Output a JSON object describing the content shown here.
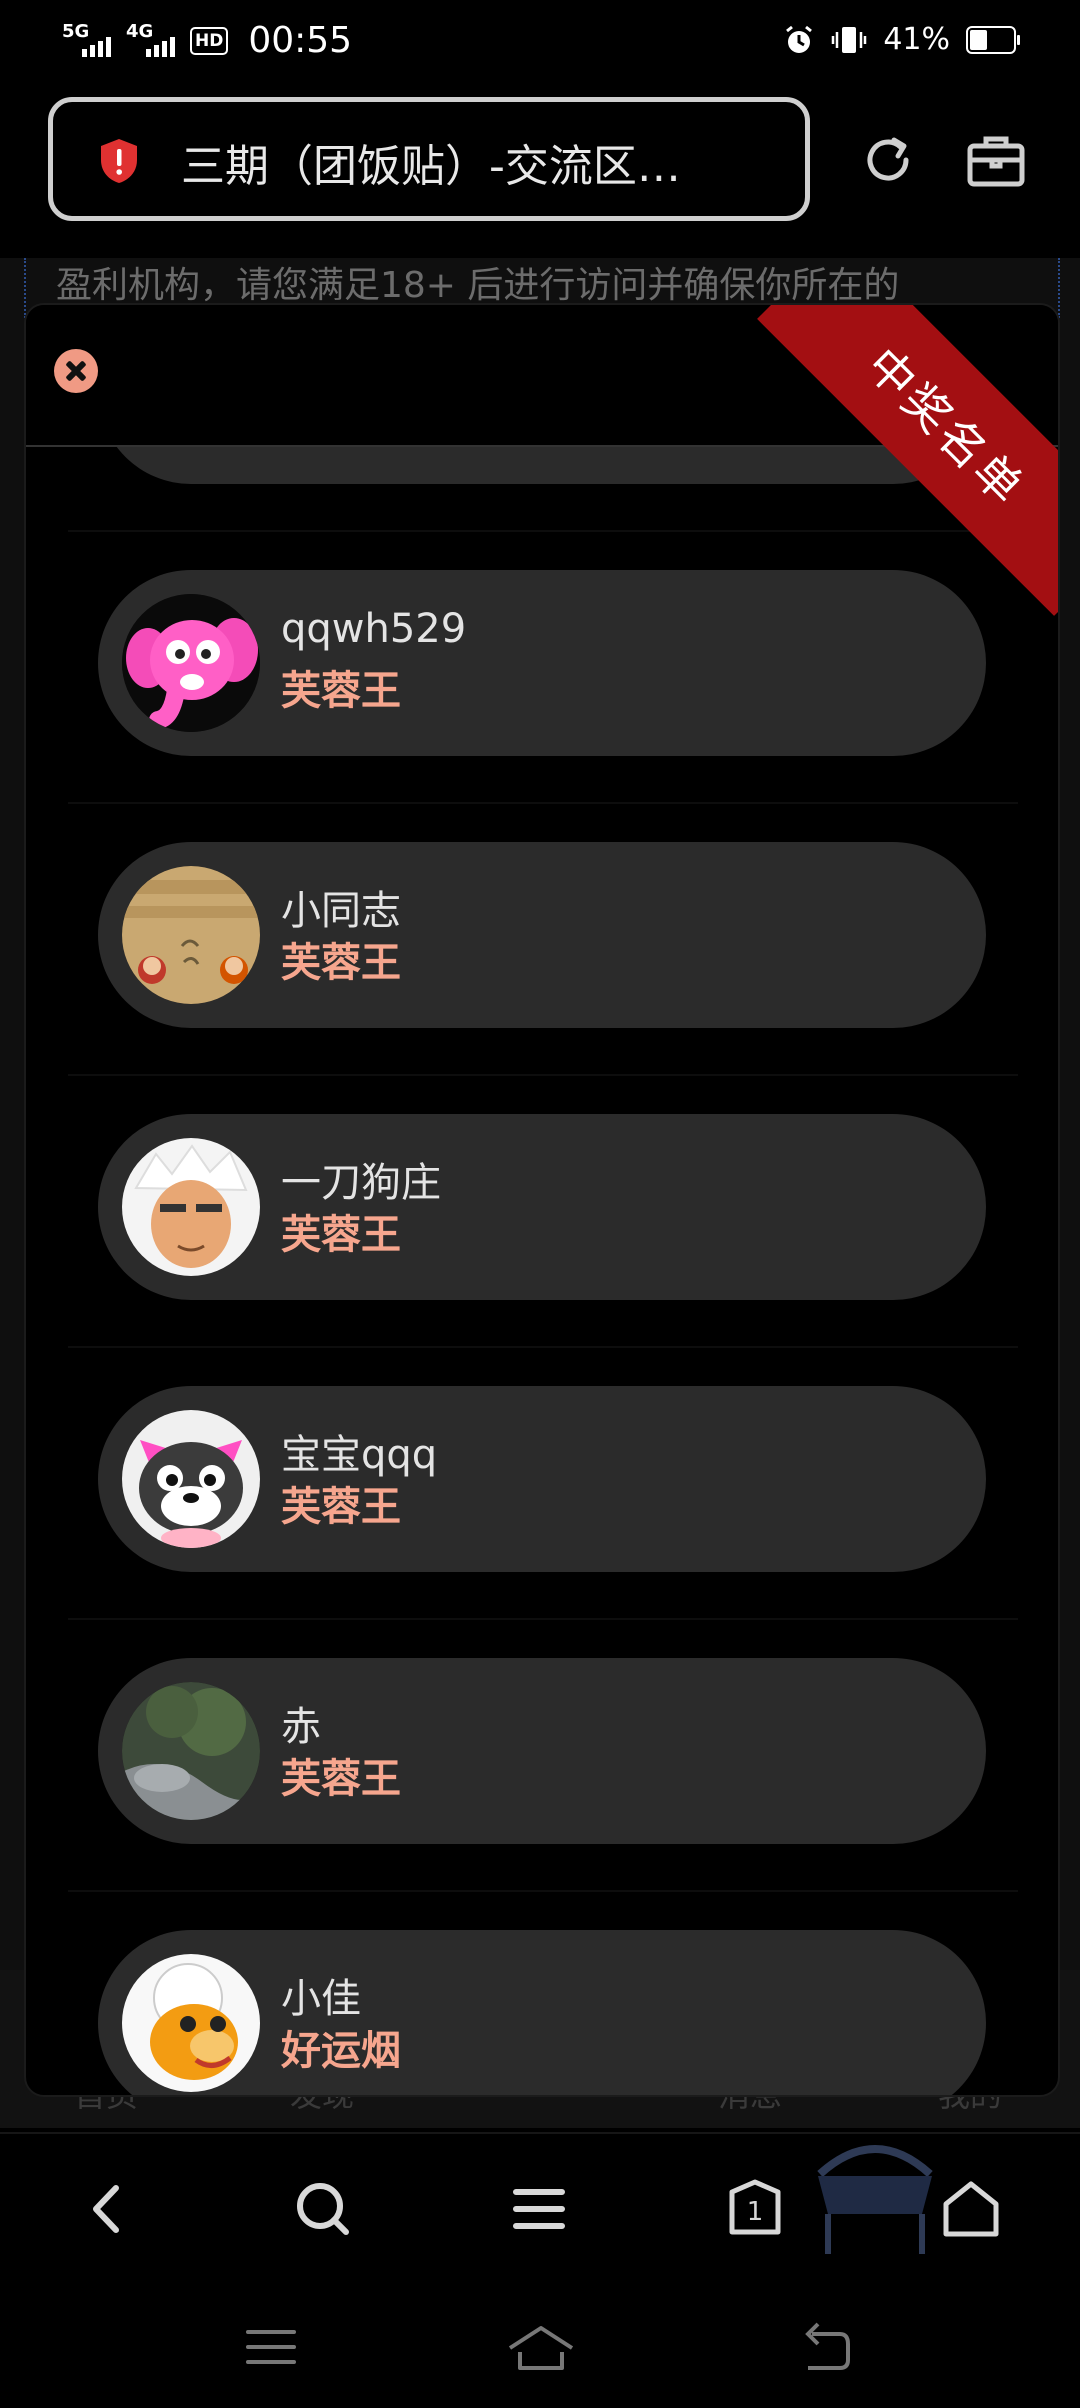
{
  "status_bar": {
    "sim1": "5G",
    "sim2": "4G",
    "hd_label": "HD",
    "time": "00:55",
    "battery_pct": "41%",
    "battery_level": 0.41
  },
  "url_bar": {
    "title": "三期（团饭贴）-交流区…"
  },
  "background_page": {
    "notice_text": "盈利机构，请您满足18+ 后进行访问并确保你所在的",
    "nav_labels": [
      "首页",
      "发现",
      "消息",
      "我的"
    ]
  },
  "modal": {
    "ribbon_text": "中奖名单",
    "winners": [
      {
        "name": "qqwh529",
        "prize": "芙蓉王",
        "avatar": "pink-elephant"
      },
      {
        "name": "小同志",
        "prize": "芙蓉王",
        "avatar": "meme-picture"
      },
      {
        "name": "一刀狗庄",
        "prize": "芙蓉王",
        "avatar": "anime-face"
      },
      {
        "name": "宝宝qqq",
        "prize": "芙蓉王",
        "avatar": "cat-face"
      },
      {
        "name": "赤",
        "prize": "芙蓉王",
        "avatar": "nature-photo"
      },
      {
        "name": "小佳",
        "prize": "好运烟",
        "avatar": "cartoon-monkey"
      }
    ]
  },
  "colors": {
    "prize": "#f6a68e",
    "ribbon": "#a30f12",
    "pill": "#2b2b2b",
    "close_button": "#f09a84"
  }
}
